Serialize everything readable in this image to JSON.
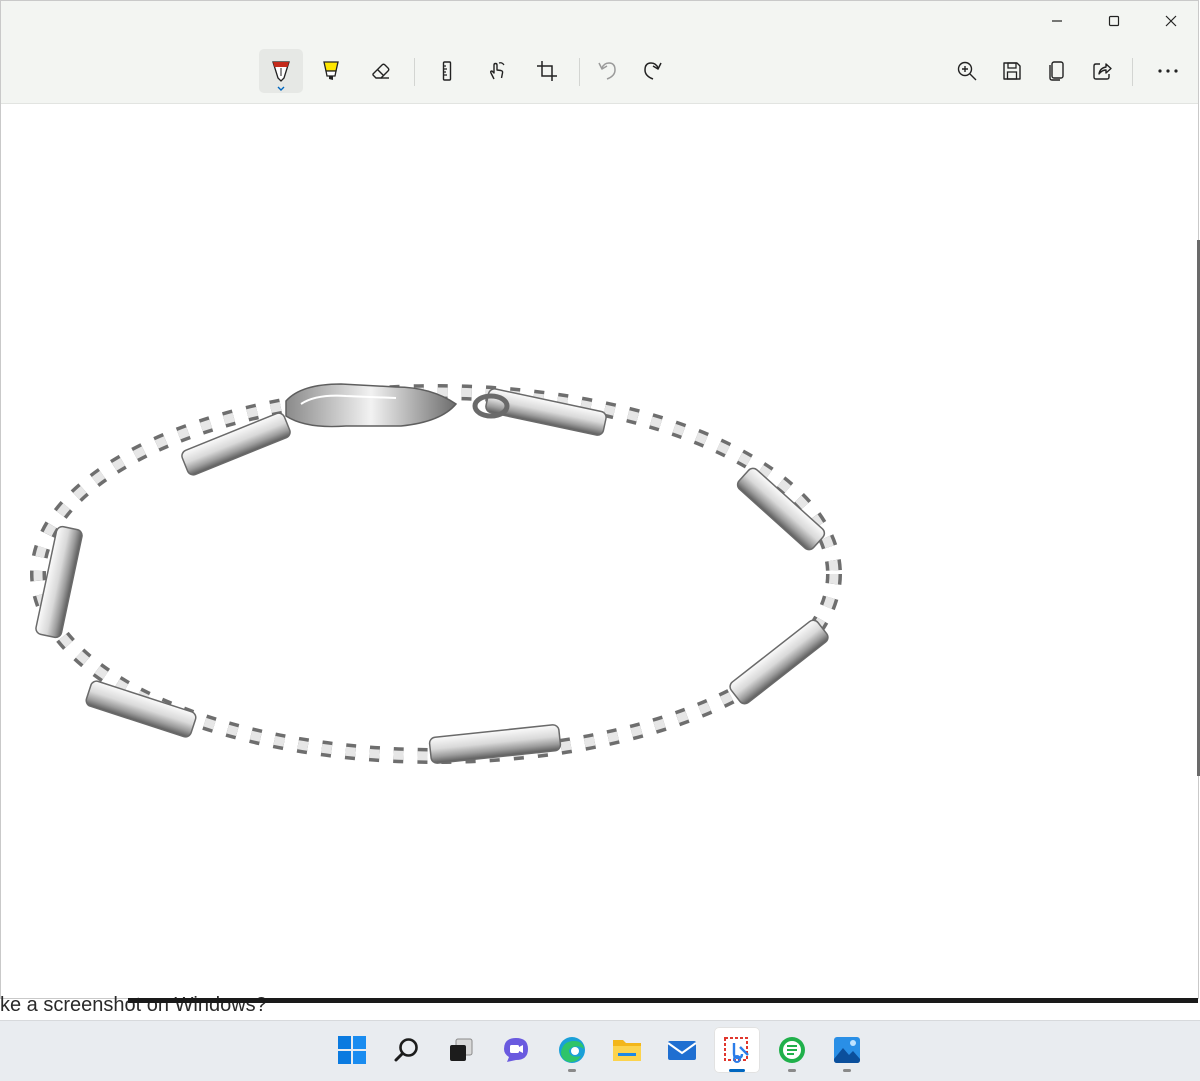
{
  "window": {
    "caption_buttons": [
      {
        "name": "minimize-icon"
      },
      {
        "name": "maximize-icon"
      },
      {
        "name": "close-icon"
      }
    ]
  },
  "toolbar": {
    "left_tools": [
      {
        "name": "ballpoint-pen-icon",
        "active": true,
        "color": "#c42b1c"
      },
      {
        "name": "highlighter-icon",
        "active": false,
        "color": "#ffe600"
      },
      {
        "name": "eraser-icon",
        "active": false
      },
      {
        "name": "ruler-icon",
        "active": false
      },
      {
        "name": "touch-writing-icon",
        "active": false
      },
      {
        "name": "crop-icon",
        "active": false
      },
      {
        "name": "undo-icon",
        "active": false,
        "disabled": true
      },
      {
        "name": "redo-icon",
        "active": false
      }
    ],
    "right_tools": [
      {
        "name": "zoom-in-icon"
      },
      {
        "name": "save-icon"
      },
      {
        "name": "copy-icon"
      },
      {
        "name": "share-icon"
      },
      {
        "name": "more-options-icon"
      }
    ]
  },
  "canvas": {
    "image_subject": "bracelet-image"
  },
  "background_window": {
    "partial_text": "ke a screenshot on Windows?"
  },
  "taskbar": {
    "items": [
      {
        "name": "start-icon",
        "running": false
      },
      {
        "name": "search-icon",
        "running": false
      },
      {
        "name": "task-view-icon",
        "running": false
      },
      {
        "name": "chat-icon",
        "running": false
      },
      {
        "name": "edge-icon",
        "running": true
      },
      {
        "name": "file-explorer-icon",
        "running": false
      },
      {
        "name": "mail-icon",
        "running": false
      },
      {
        "name": "snipping-tool-icon",
        "running": true,
        "active": true
      },
      {
        "name": "green-app-icon",
        "running": true
      },
      {
        "name": "photos-icon",
        "running": true
      }
    ],
    "accent_color": "#0067c0"
  }
}
